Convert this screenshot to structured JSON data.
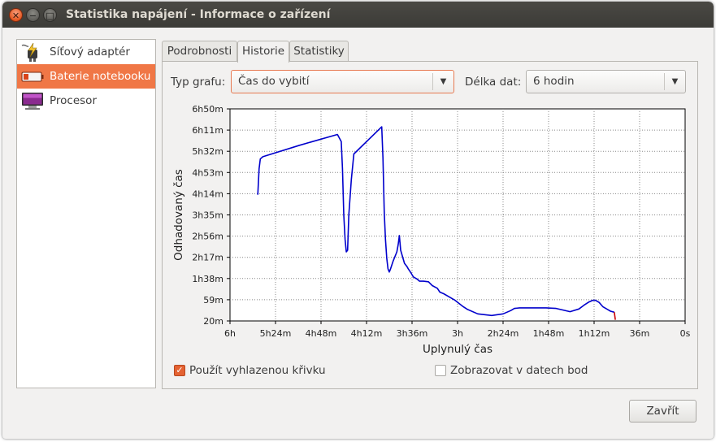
{
  "window": {
    "title": "Statistika napájení - Informace o zařízení",
    "close_glyph": "✕",
    "minimize_glyph": "−",
    "maximize_glyph": "□"
  },
  "devices": [
    {
      "label": "Síťový adaptér",
      "icon": "ac-adapter-icon"
    },
    {
      "label": "Baterie notebooku",
      "icon": "battery-icon",
      "selected": true
    },
    {
      "label": "Procesor",
      "icon": "processor-monitor-icon"
    }
  ],
  "tabs": [
    {
      "label": "Podrobnosti"
    },
    {
      "label": "Historie",
      "active": true
    },
    {
      "label": "Statistiky"
    }
  ],
  "controls": {
    "graph_type_label": "Typ grafu:",
    "graph_type_value": "Čas do vybití",
    "data_length_label": "Délka dat:",
    "data_length_value": "6 hodin",
    "arrow_glyph": "▼",
    "smooth_label": "Použít vyhlazenou křivku",
    "smooth_checked": true,
    "smooth_check_glyph": "✓",
    "points_label": "Zobrazovat v datech bod",
    "points_checked": false,
    "close_button": "Zavřít"
  },
  "colors": {
    "accent": "#f07746",
    "series": "#0000cc",
    "series_end": "#cc0000"
  },
  "chart_data": {
    "type": "line",
    "xlabel": "Uplynulý čas",
    "ylabel": "Odhadovaný čas",
    "x_tick_labels": [
      "6h",
      "5h24m",
      "4h48m",
      "4h12m",
      "3h36m",
      "3h",
      "2h24m",
      "1h48m",
      "1h12m",
      "36m",
      "0s"
    ],
    "y_tick_labels": [
      "20m",
      "59m",
      "1h38m",
      "2h17m",
      "2h56m",
      "3h35m",
      "4h14m",
      "4h53m",
      "5h32m",
      "6h11m",
      "6h50m"
    ],
    "xlim_minutes_ago": [
      360,
      0
    ],
    "ylim_minutes": [
      20,
      410
    ],
    "grid": true,
    "series": [
      {
        "color": "#0000cc",
        "x_minutes_ago": [
          338,
          337,
          336,
          335,
          334,
          305,
          275,
          272,
          271,
          270,
          269,
          268,
          267,
          266,
          264,
          262,
          240,
          239,
          238,
          237,
          236,
          235,
          234,
          233,
          231,
          228,
          227,
          226,
          225,
          222,
          220,
          219,
          217,
          216,
          215,
          212,
          210,
          207,
          203,
          200,
          196,
          194,
          191,
          188,
          182,
          176,
          172,
          164,
          153,
          144,
          138,
          135,
          131,
          126,
          119,
          115,
          110,
          102,
          91,
          84,
          80,
          76,
          73,
          71,
          68,
          65,
          62,
          59,
          56
        ],
        "y_minutes": [
          252,
          300,
          318,
          320,
          322,
          343,
          363,
          350,
          300,
          215,
          170,
          147,
          150,
          215,
          280,
          327,
          377,
          320,
          220,
          170,
          135,
          116,
          110,
          116,
          130,
          147,
          160,
          177,
          150,
          126,
          120,
          116,
          109,
          105,
          101,
          97,
          93,
          93,
          92,
          85,
          80,
          73,
          70,
          66,
          58,
          47,
          41,
          33,
          30,
          33,
          39,
          43,
          44,
          44,
          44,
          44,
          44,
          43,
          37,
          42,
          49,
          55,
          58,
          58,
          54,
          46,
          42,
          38,
          36
        ]
      }
    ]
  }
}
